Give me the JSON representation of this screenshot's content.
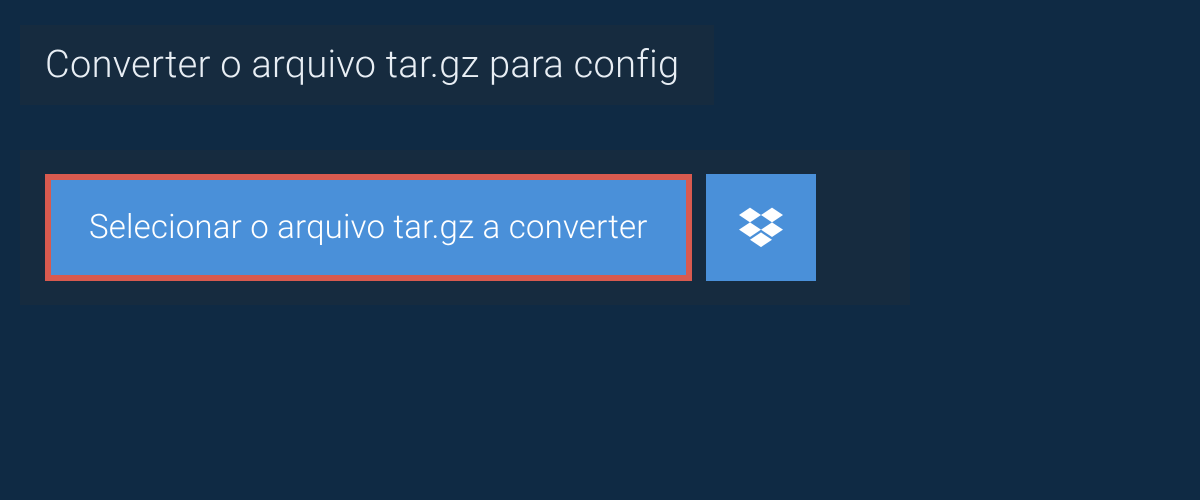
{
  "header": {
    "title": "Converter o arquivo tar.gz para config"
  },
  "upload": {
    "select_label": "Selecionar o arquivo tar.gz a converter"
  }
}
